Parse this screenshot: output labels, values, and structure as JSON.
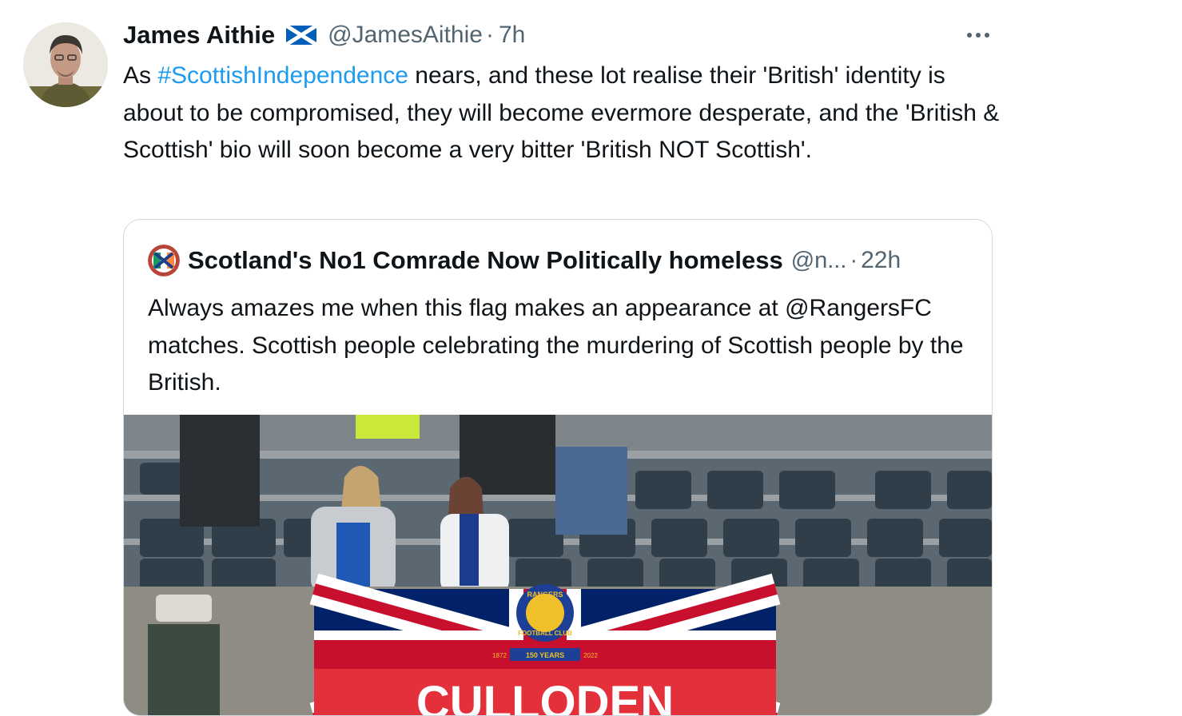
{
  "tweet": {
    "author_name": "James Aithie",
    "author_handle": "@JamesAithie",
    "separator": "·",
    "time": "7h",
    "text_before_hashtag": "As ",
    "hashtag": "#ScottishIndependence",
    "text_after_hashtag": " nears, and these lot realise their 'British' identity is about to be compromised, they will become evermore desperate, and the 'British & Scottish' bio will soon become a very bitter 'British NOT Scottish'.",
    "more_icon": "more-horizontal-icon",
    "badge_icon": "scotland-flag-icon"
  },
  "quote": {
    "author_name": "Scotland's No1 Comrade Now Politically homeless",
    "author_handle": "@n...",
    "separator": "·",
    "time": "22h",
    "text": "Always amazes me when this flag makes an appearance at @RangersFC matches. Scottish people celebrating the murdering of Scottish people by the British.",
    "flag_text": "CULLODEN",
    "crest_top": "RANGERS",
    "crest_bottom": "FOOTBALL CLUB",
    "crest_banner": "150 YEARS",
    "crest_year_left": "1872",
    "crest_year_right": "2022"
  },
  "colors": {
    "text": "#0f1419",
    "secondary": "#536471",
    "link": "#1d9bf0",
    "border": "#cfd9de",
    "saltire": "#005eb8"
  }
}
